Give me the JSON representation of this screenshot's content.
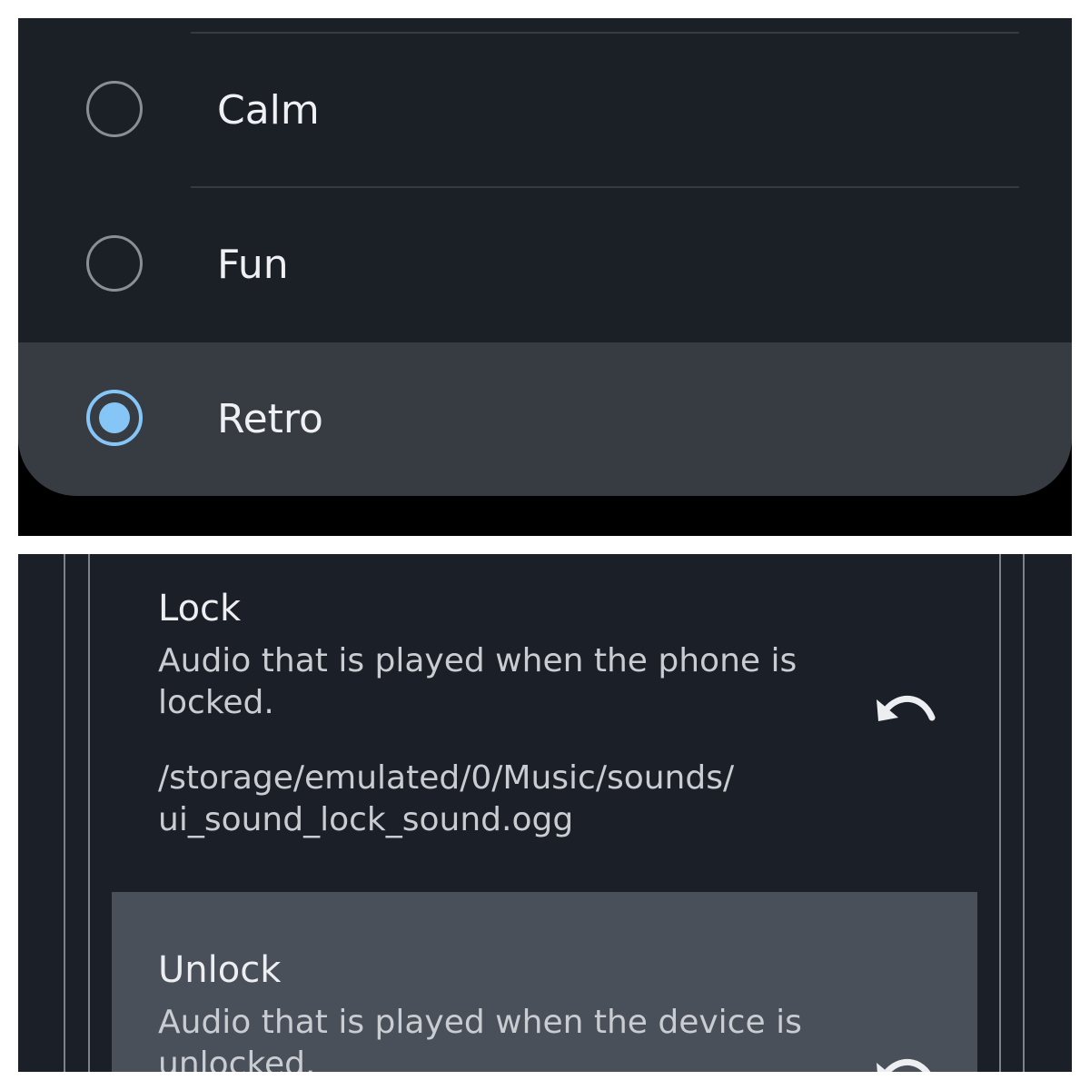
{
  "ringtone_options": {
    "items": [
      {
        "label": "Calm",
        "selected": false
      },
      {
        "label": "Fun",
        "selected": false
      },
      {
        "label": "Retro",
        "selected": true
      }
    ],
    "accent_color": "#86c6f7"
  },
  "sound_preferences": {
    "lock": {
      "title": "Lock",
      "summary": "Audio that is played when the phone is locked.",
      "path_line1": "/storage/emulated/0/Music/sounds/",
      "path_line2": "ui_sound_lock_sound.ogg",
      "action_icon": "undo-icon"
    },
    "unlock": {
      "title": "Unlock",
      "summary": "Audio that is played when the device is unlocked.",
      "action_icon": "undo-icon"
    }
  }
}
